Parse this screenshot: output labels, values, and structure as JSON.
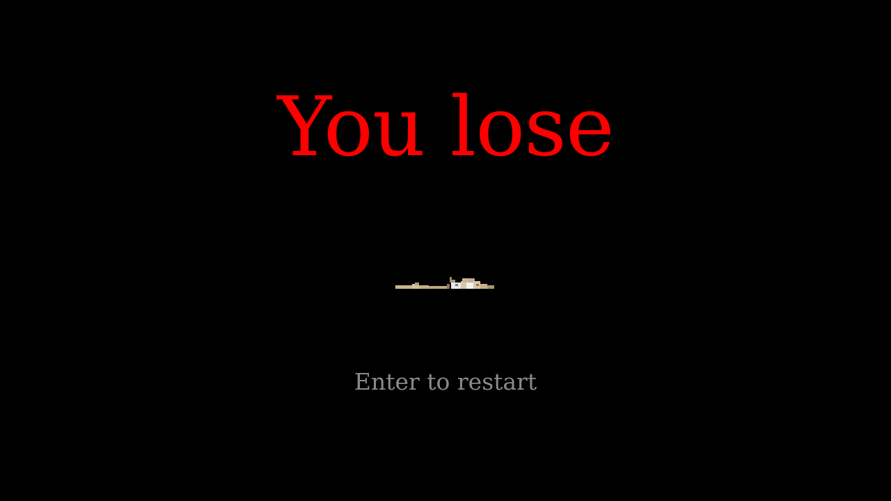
{
  "screen": {
    "title": "You lose",
    "prompt": "Enter to restart"
  },
  "colors": {
    "background": "#000000",
    "title": "#ff0000",
    "prompt": "#8a8a8a"
  },
  "sprite": {
    "icon": "fallen-player-sprite-icon"
  }
}
